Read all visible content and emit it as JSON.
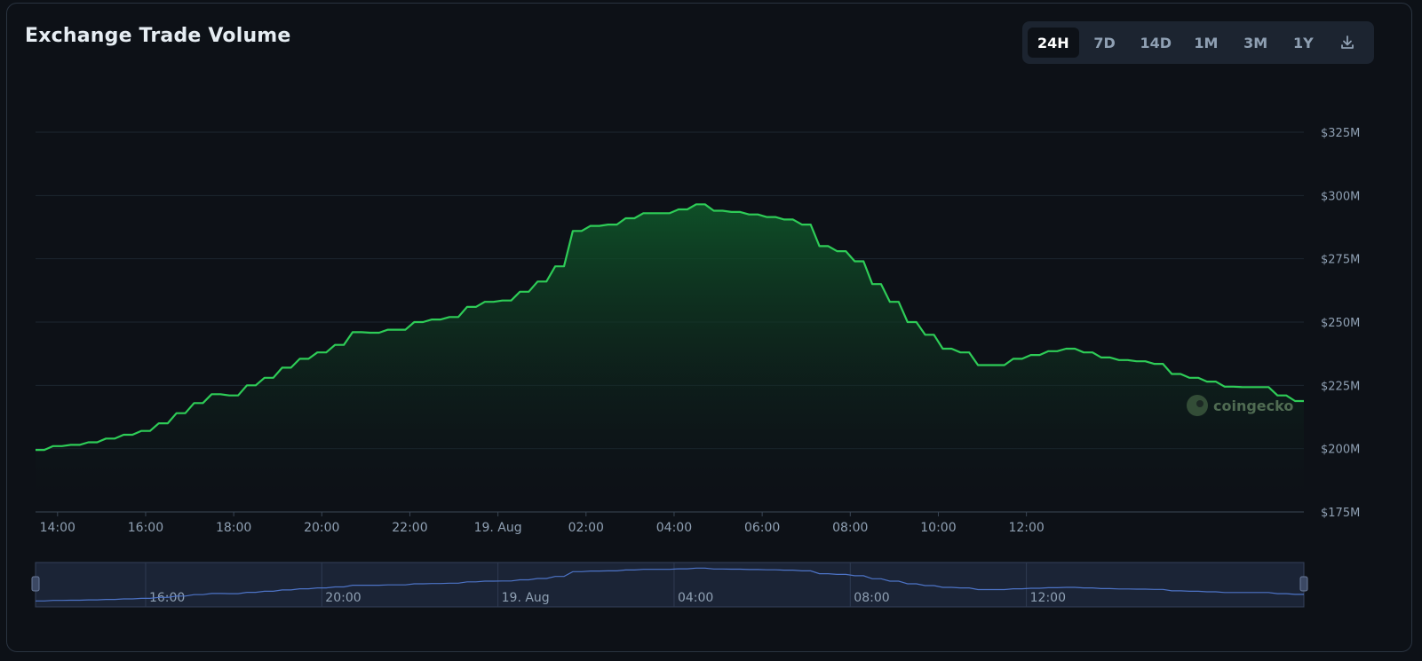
{
  "header": {
    "title": "Exchange Trade Volume"
  },
  "range_buttons": [
    {
      "label": "24H",
      "active": true
    },
    {
      "label": "7D",
      "active": false
    },
    {
      "label": "14D",
      "active": false
    },
    {
      "label": "1M",
      "active": false
    },
    {
      "label": "3M",
      "active": false
    },
    {
      "label": "1Y",
      "active": false
    }
  ],
  "download_icon": "download-icon",
  "watermark": {
    "text": "coingecko",
    "icon": "coingecko-logo-icon"
  },
  "colors": {
    "line": "#2ecc57",
    "fill_top": "#0f5a2a",
    "grid": "#1d2630",
    "axis_text": "#8fa0b3",
    "navigator_line": "#4d73c6",
    "navigator_bg": "#1b2436"
  },
  "chart_data": {
    "type": "area",
    "title": "Exchange Trade Volume",
    "xlabel": "",
    "ylabel": "",
    "x_start": 13.5,
    "x_step": 0.2,
    "x_tick_labels": [
      {
        "x": 14,
        "label": "14:00"
      },
      {
        "x": 16,
        "label": "16:00"
      },
      {
        "x": 18,
        "label": "18:00"
      },
      {
        "x": 20,
        "label": "20:00"
      },
      {
        "x": 22,
        "label": "22:00"
      },
      {
        "x": 24,
        "label": "19. Aug"
      },
      {
        "x": 26,
        "label": "02:00"
      },
      {
        "x": 28,
        "label": "04:00"
      },
      {
        "x": 30,
        "label": "06:00"
      },
      {
        "x": 32,
        "label": "08:00"
      },
      {
        "x": 34,
        "label": "10:00"
      },
      {
        "x": 36,
        "label": "12:00"
      }
    ],
    "y_ticks": [
      175,
      200,
      225,
      250,
      275,
      300,
      325
    ],
    "y_tick_labels": [
      "$175M",
      "$200M",
      "$225M",
      "$250M",
      "$275M",
      "$300M",
      "$325M"
    ],
    "ylim": [
      175,
      325
    ],
    "grid": true,
    "legend": "none",
    "series": [
      {
        "unit": "$M",
        "values": [
          199.5,
          199.5,
          201,
          201,
          201.5,
          201.5,
          202.5,
          202.5,
          204,
          204,
          205.5,
          205.5,
          207,
          207,
          210,
          210,
          214,
          214,
          218,
          218,
          221.5,
          221.5,
          221,
          221,
          225,
          225,
          228,
          228,
          232,
          232,
          235.5,
          235.5,
          238,
          238,
          241,
          241,
          246,
          246,
          245.8,
          245.8,
          247,
          247,
          247,
          250,
          250,
          251,
          251,
          252,
          252,
          256,
          256,
          258,
          258,
          258.5,
          258.5,
          262,
          262,
          266,
          266,
          272,
          272,
          286,
          286,
          288,
          288,
          288.5,
          288.5,
          291,
          291,
          293,
          293,
          293,
          293,
          294.5,
          294.5,
          296.5,
          296.5,
          294,
          294,
          293.5,
          293.5,
          292.5,
          292.5,
          291.5,
          291.5,
          290.5,
          290.5,
          288.5,
          288.5,
          280,
          280,
          278,
          278,
          274,
          274,
          265,
          265,
          258,
          258,
          250,
          250,
          245,
          245,
          239.5,
          239.5,
          238,
          238,
          233,
          233,
          233,
          233,
          235.5,
          235.5,
          237,
          237,
          238.5,
          238.5,
          239.5,
          239.5,
          238,
          238,
          236,
          236,
          235,
          235,
          234.5,
          234.5,
          233.5,
          233.5,
          229.5,
          229.5,
          228,
          228,
          226.5,
          226.5,
          224.5,
          224.5,
          224.3,
          224.3,
          224.3,
          224.3,
          221,
          221,
          218.8,
          218.8
        ]
      }
    ]
  },
  "navigator": {
    "tick_labels": [
      {
        "x": 16,
        "label": "16:00"
      },
      {
        "x": 20,
        "label": "20:00"
      },
      {
        "x": 24,
        "label": "19. Aug"
      },
      {
        "x": 28,
        "label": "04:00"
      },
      {
        "x": 32,
        "label": "08:00"
      },
      {
        "x": 36,
        "label": "12:00"
      }
    ]
  }
}
